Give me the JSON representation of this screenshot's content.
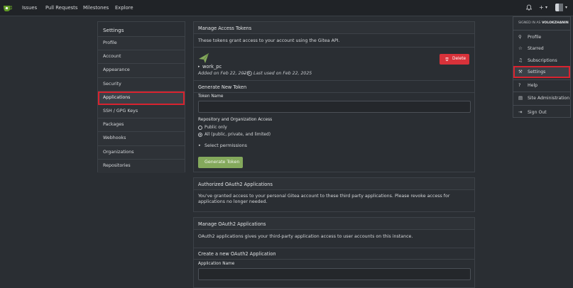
{
  "topbar": {
    "nav": [
      "Issues",
      "Pull Requests",
      "Milestones",
      "Explore"
    ],
    "icons": [
      "bell-icon",
      "plus-icon",
      "chevron-down-icon"
    ]
  },
  "settings_menu": {
    "title": "Settings",
    "items": [
      "Profile",
      "Account",
      "Appearance",
      "Security",
      "Applications",
      "SSH / GPG Keys",
      "Packages",
      "Webhooks",
      "Organizations",
      "Repositories"
    ],
    "active": "Applications"
  },
  "access_tokens": {
    "header": "Manage Access Tokens",
    "description": "These tokens grant access to your account using the Gitea API.",
    "token_name": "work_pc",
    "added": "Added on Feb 22, 2025",
    "separator": "—",
    "last_used": "Last used on Feb 22, 2025",
    "delete_label": "Delete",
    "generate_header": "Generate New Token",
    "token_name_label": "Token Name",
    "token_name_value": "",
    "repo_access_label": "Repository and Organization Access",
    "radio_public": "Public only",
    "radio_all": "All (public, private, and limited)",
    "select_permissions": "Select permissions",
    "generate_button": "Generate Token"
  },
  "authorized_oauth": {
    "header": "Authorized OAuth2 Applications",
    "description": "You've granted access to your personal Gitea account to these third party applications. Please revoke access for applications no longer needed."
  },
  "manage_oauth": {
    "header": "Manage OAuth2 Applications",
    "description": "OAuth2 applications gives your third-party application access to user accounts on this instance.",
    "create_header": "Create a new OAuth2 Application",
    "app_name_label": "Application Name",
    "app_name_value": ""
  },
  "user_dropdown": {
    "signed_in_prefix": "SIGNED IN AS",
    "username": "VOLOKZHANIN",
    "items": [
      "Profile",
      "Starred",
      "Subscriptions",
      "Settings",
      "Help",
      "Site Administration",
      "Sign Out"
    ],
    "active": "Settings"
  },
  "colors": {
    "accent_green": "#84a95c",
    "delete_red": "#d8323a",
    "highlight_red": "#d8232f",
    "logo_green": "#609926"
  }
}
